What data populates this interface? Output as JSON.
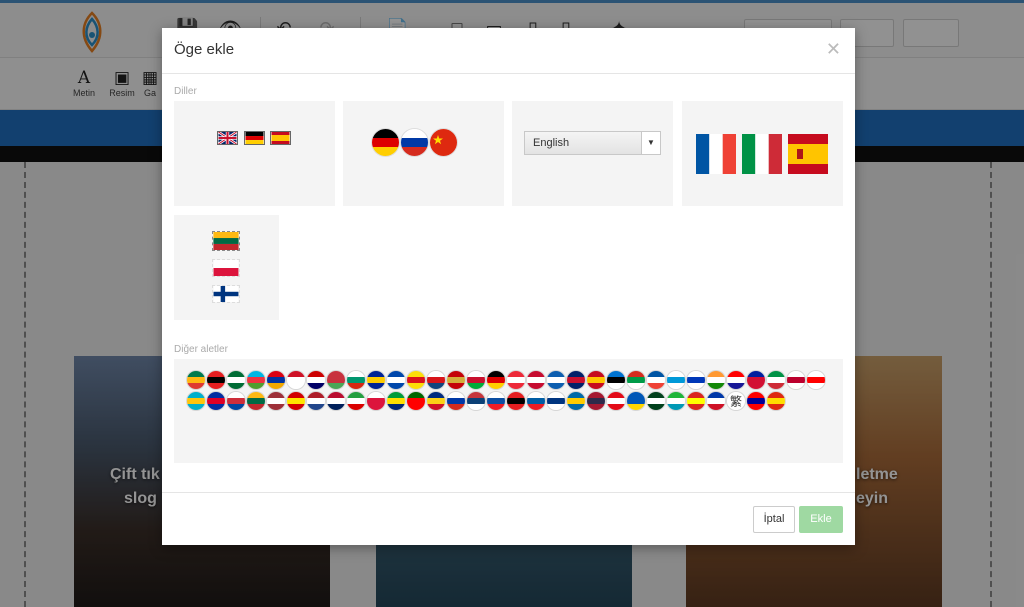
{
  "editor": {
    "tools": [
      {
        "label": "Metin",
        "icon": "text-icon"
      },
      {
        "label": "Resim",
        "icon": "image-icon"
      },
      {
        "label": "Ga",
        "icon": "gallery-icon"
      }
    ],
    "cards": [
      {
        "text_line1": "Çift tık",
        "text_line2": "slog"
      },
      {
        "text_line1": "letme",
        "text_line2": "eyin"
      }
    ]
  },
  "modal": {
    "title": "Öge ekle",
    "close_icon": "close-icon",
    "section_languages": "Diller",
    "section_other": "Diğer aletler",
    "language_select": {
      "selected": "English"
    },
    "cancel_label": "İptal",
    "add_label": "Ekle",
    "add_color": "#9fd9a2"
  },
  "flag_grid": {
    "row1": [
      "south-africa",
      "albania",
      "saudi-arabia",
      "azerbaijan",
      "armenia",
      "indonesia",
      "malaysia",
      "belarus",
      "bulgaria",
      "bosnia",
      "el-salvador",
      "catalonia",
      "czechia",
      "montenegro",
      "wales",
      "germany",
      "austria",
      "denmark",
      "greece",
      "uk",
      "spain",
      "estonia",
      "basque",
      "france",
      "galicia",
      "israel",
      "india",
      "croatia",
      "haiti",
      "italy",
      "japan",
      "georgia"
    ],
    "row2": [
      "kazakhstan",
      "cambodia",
      "south-korea",
      "lithuania",
      "latvia",
      "macedonia",
      "netherlands",
      "norway",
      "iran",
      "poland",
      "brazil",
      "portugal",
      "romania",
      "russia",
      "serbia",
      "slovakia",
      "albania-2",
      "slovenia",
      "finland",
      "sweden",
      "thailand",
      "turkey",
      "ukraine",
      "pakistan",
      "uzbekistan",
      "vietnam",
      "philippines",
      "traditional-chinese",
      "taiwan",
      "china"
    ]
  }
}
